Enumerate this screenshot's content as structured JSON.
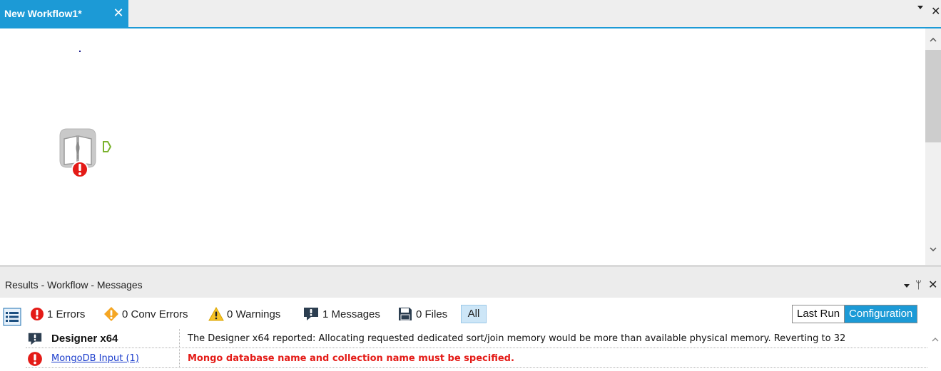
{
  "tab": {
    "title": "New Workflow1*",
    "close_glyph": "✕"
  },
  "tabbar": {
    "menu_icon": "dropdown-arrow-icon",
    "close_glyph": "✕"
  },
  "canvas": {
    "tool": {
      "name": "MongoDB Input",
      "icon": "mongodb-input-tool-icon",
      "status": "error"
    }
  },
  "results": {
    "title": "Results - Workflow - Messages",
    "pin_glyph": "ᛘ",
    "close_glyph": "✕"
  },
  "filters": {
    "errors": "1 Errors",
    "conv_errors": "0 Conv Errors",
    "warnings": "0 Warnings",
    "messages": "1 Messages",
    "files": "0 Files",
    "all": "All",
    "last_run": "Last Run",
    "configuration": "Configuration",
    "active_view": "Configuration"
  },
  "messages": [
    {
      "type": "message",
      "icon": "message-icon",
      "source": "Designer x64",
      "text": "The Designer x64 reported: Allocating requested dedicated sort/join memory would be more than available physical memory.  Reverting to 32"
    },
    {
      "type": "error",
      "icon": "error-icon",
      "source": "MongoDB Input (1)",
      "text": "Mongo database name and collection name must be specified."
    }
  ],
  "colors": {
    "accent": "#1c9ad6",
    "error": "#e41b17",
    "warning": "#f5a623",
    "link": "#1a3ccc"
  }
}
